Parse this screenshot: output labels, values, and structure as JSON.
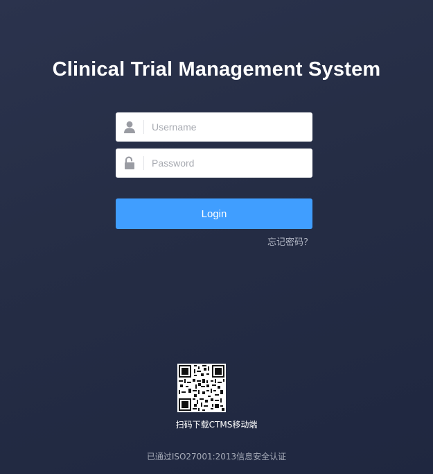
{
  "app": {
    "title": "Clinical Trial Management System"
  },
  "form": {
    "username": {
      "placeholder": "Username",
      "value": "",
      "icon": "user-icon"
    },
    "password": {
      "placeholder": "Password",
      "value": "",
      "icon": "unlock-icon"
    },
    "login_label": "Login",
    "forgot_label": "忘记密码？"
  },
  "footer": {
    "qr_caption": "扫码下载CTMS移动端",
    "certification": "已通过ISO27001:2013信息安全认证"
  },
  "colors": {
    "background": "#262e46",
    "accent": "#409eff",
    "title": "#ffffff",
    "muted_text": "#a6abb8",
    "icon": "#9a9ca3"
  }
}
